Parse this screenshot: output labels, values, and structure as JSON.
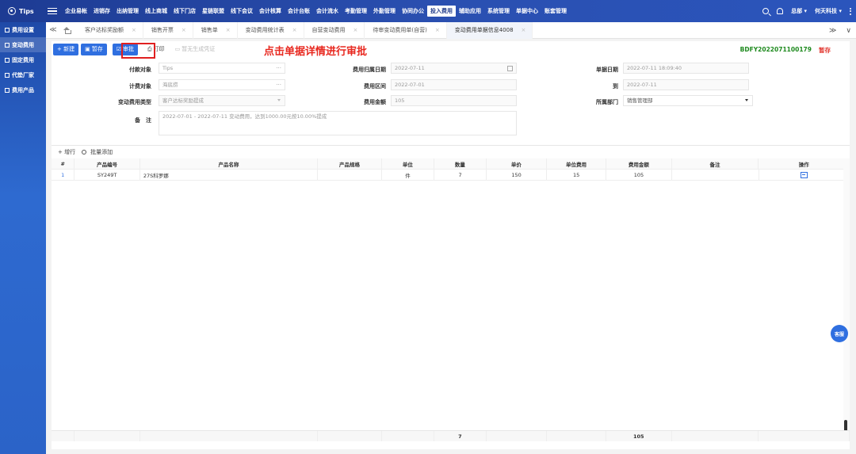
{
  "app": {
    "name": "Tips"
  },
  "topnav": {
    "items": [
      "企业易帐",
      "进销存",
      "出纳管理",
      "线上商城",
      "线下门店",
      "星链联盟",
      "线下会议",
      "会计核算",
      "会计台账",
      "会计流水",
      "考勤管理",
      "外勤管理",
      "协同办公",
      "投入费用",
      "辅助应用",
      "系统管理",
      "单据中心",
      "账套管理"
    ],
    "active_index": 13,
    "user_menu": "总部 ▾",
    "company_menu": "何天科技 ▾"
  },
  "sidebar": {
    "items": [
      "费用设置",
      "变动费用",
      "固定费用",
      "代垫厂家",
      "费用产品"
    ],
    "active_index": 1
  },
  "tabs": {
    "items": [
      "客户达标奖励额",
      "销售开票",
      "销售单",
      "变动费用统计表",
      "自营变动费用",
      "待审变动费用单(自营)",
      "变动费用单据信息4008"
    ],
    "active_index": 6,
    "close_glyph": "×",
    "nav_left": "≪",
    "nav_right": "≫",
    "nav_down": "∨"
  },
  "toolbar": {
    "new_label": "+ 新建",
    "save_label": "暂存",
    "approve_label": "审批",
    "print_label": "打印",
    "voucher_label": "暂无生成凭证"
  },
  "annotation": "点击单据详情进行审批",
  "document": {
    "number": "BDFY2022071100179",
    "status": "暂存"
  },
  "form": {
    "payer_label": "付款对象",
    "payer_value": "Tips",
    "cost_object_label": "计费对象",
    "cost_object_value": "海底捞",
    "change_type_label": "变动费用类型",
    "change_type_value": "客户达标奖励提成",
    "fee_date_label": "费用归属日期",
    "fee_date_value": "2022-07-11",
    "fee_range_label": "费用区间",
    "fee_range_value": "2022-07-01",
    "fee_amount_label": "费用金额",
    "fee_amount_value": "105",
    "doc_date_label": "单据日期",
    "doc_date_value": "2022-07-11 18:09:40",
    "to_label": "到",
    "to_value": "2022-07-11",
    "dept_label": "所属部门",
    "dept_value": "销售管理部",
    "remark_label": "备　注",
    "remark_value": "2022-07-01 - 2022-07-11 变动费用，达到1000.00元按10.00%提成",
    "more_glyph": "···"
  },
  "grid": {
    "add_row_label": "+ 增行",
    "batch_add_label": "批量添加",
    "columns": [
      "#",
      "产品编号",
      "产品名称",
      "产品规格",
      "单位",
      "数量",
      "单价",
      "单位费用",
      "费用金额",
      "备注",
      "操作"
    ],
    "rows": [
      {
        "index": "1",
        "code": "SY249T",
        "name": "27S科罗娜",
        "spec": "",
        "unit": "件",
        "qty": "7",
        "price": "150",
        "unit_fee": "15",
        "amount": "105",
        "remark": ""
      }
    ],
    "footer": {
      "qty_total": "7",
      "amount_total": "105"
    }
  },
  "kefu_label": "客服",
  "colors": {
    "primary": "#2f6fe0",
    "topbar": "#1f3a8a",
    "annotation": "#e8281f",
    "doc_number": "#1e8a1e",
    "status": "#e0342c"
  }
}
